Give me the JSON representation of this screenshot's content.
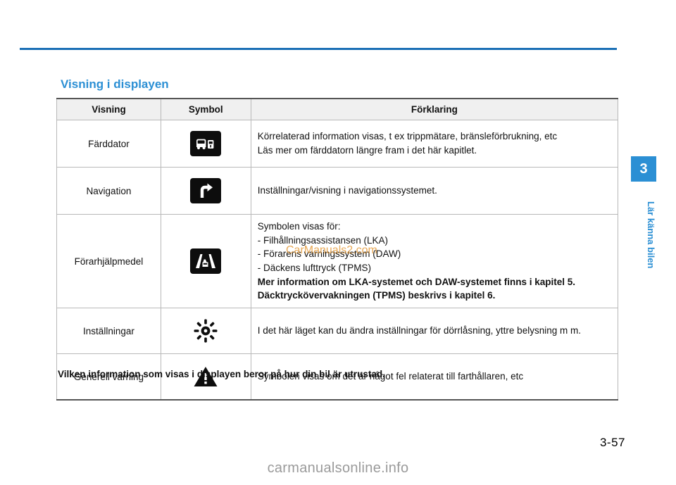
{
  "page": {
    "number": "3-57",
    "chapter_number": "3",
    "chapter_label": "Lär känna bilen",
    "section_title": "Visning i displayen",
    "note": "Vilken information som visas i displayen beror på hur din bil är utrustad.",
    "watermark_mid": "CarManuals2.com",
    "watermark_bottom": "carmanualsonline.info",
    "accent_color": "#2b8fd4"
  },
  "table": {
    "headers": [
      "Visning",
      "Symbol",
      "Förklaring"
    ],
    "rows": [
      {
        "visning": "Färddator",
        "symbol_name": "trip-computer-icon",
        "forklaring_lines": [
          "Körrelaterad information visas, t ex trippmätare, bränsleförbrukning, etc",
          "Läs mer om färddatorn längre fram i det här kapitlet."
        ]
      },
      {
        "visning": "Navigation",
        "symbol_name": "navigation-arrow-icon",
        "forklaring_lines": [
          "Inställningar/visning i navigationssystemet."
        ]
      },
      {
        "visning": "Förarhjälpmedel",
        "symbol_name": "driver-assistance-lane-icon",
        "forklaring_lines": [
          "Symbolen visas för:",
          "- Filhållningsassistansen (LKA)",
          "- Förarens varningssystem (DAW)",
          "- Däckens lufttryck (TPMS)"
        ],
        "forklaring_bold_lines": [
          "Mer information om LKA-systemet och DAW-systemet finns i kapitel 5.",
          "Däcktrycköver­vakningen (TPMS) beskrivs i kapitel 6."
        ]
      },
      {
        "visning": "Inställningar",
        "symbol_name": "settings-gear-icon",
        "forklaring_lines": [
          "I det här läget kan du ändra inställningar för dörrlåsning, yttre belysning m m."
        ]
      },
      {
        "visning": "Generell varning",
        "symbol_name": "general-warning-triangle-icon",
        "forklaring_lines": [
          "Symbolen visas om det är något fel relaterat till farthållaren, etc"
        ]
      }
    ]
  }
}
